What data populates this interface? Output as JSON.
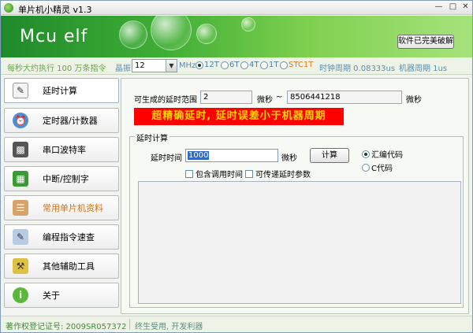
{
  "window": {
    "title": "单片机小精灵  v1.3"
  },
  "banner": {
    "logo": "Mcu elf",
    "crack_button": "软件已完美破解"
  },
  "config": {
    "speed_text": "每秒大约执行 100 万条指令",
    "crystal_label": "晶振",
    "crystal_value": "12",
    "mhz_label": "MHz",
    "modes": [
      "12T",
      "6T",
      "4T",
      "1T",
      "STC1T"
    ],
    "selected_mode": "12T",
    "clock_period": "时钟周期  0.08333us",
    "machine_period": "机器周期  1us"
  },
  "sidebar": {
    "items": [
      {
        "label": "延时计算",
        "icon": "delay-calc-icon"
      },
      {
        "label": "定时器/计数器",
        "icon": "alarm-clock-icon"
      },
      {
        "label": "串口波特率",
        "icon": "serial-port-icon"
      },
      {
        "label": "中断/控制字",
        "icon": "chip-icon"
      },
      {
        "label": "常用单片机资料",
        "icon": "book-icon"
      },
      {
        "label": "编程指令速查",
        "icon": "notebook-icon"
      },
      {
        "label": "其他辅助工具",
        "icon": "tools-icon"
      },
      {
        "label": "关于",
        "icon": "info-icon"
      }
    ],
    "active_index": 0
  },
  "delay": {
    "range_label": "可生成的延时范围",
    "min_value": "2",
    "min_unit": "微秒",
    "tilde": "~",
    "max_value": "8506441218",
    "max_unit": "微秒",
    "warning": "超精确延时, 延时误差小于机器周期",
    "group_title": "延时计算",
    "time_label": "延时时间",
    "time_value": "1000",
    "time_unit": "微秒",
    "calc_button": "计算",
    "include_call_label": "包含调用时间",
    "pass_param_label": "可传递延时参数",
    "asm_option": "汇编代码",
    "c_option": "C代码",
    "selected_output": "汇编代码",
    "output_text": ""
  },
  "status": {
    "copyright": "著作权登记证号: 2009SR057372",
    "slogan": "终生受用, 开发利器"
  },
  "colors": {
    "banner_green": "#3fae35",
    "warning_bg": "#ff0000",
    "warning_text": "#ffd500",
    "active_nav_orange": "#d0721c"
  }
}
